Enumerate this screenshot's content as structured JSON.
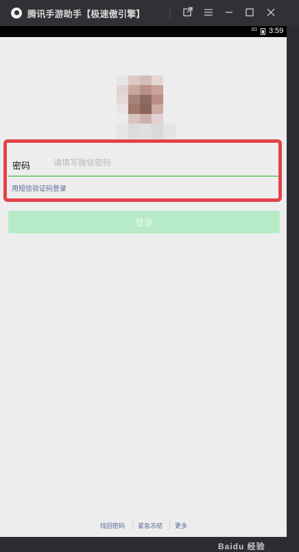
{
  "window": {
    "title": "腾讯手游助手【极速傲引擎】",
    "logo_icon": "tencent-gaming-buddy-icon",
    "controls": {
      "popout_icon": "popout-icon",
      "menu_icon": "hamburger-menu-icon",
      "minimize_icon": "minimize-icon",
      "maximize_icon": "maximize-icon",
      "close_icon": "close-icon"
    }
  },
  "statusbar": {
    "network": "3G",
    "time": "3:59"
  },
  "login": {
    "password_label": "密码",
    "password_placeholder": "请填写微信密码",
    "sms_login_link": "用短信验证码登录",
    "login_button": "登录",
    "button_color": "#b7ebc7",
    "underline_color": "#1aad19"
  },
  "footer": {
    "links": [
      "找回密码",
      "紧急冻结",
      "更多"
    ]
  },
  "watermark": "Baidu 经验",
  "annotation": {
    "highlight_color": "#e2424a"
  }
}
